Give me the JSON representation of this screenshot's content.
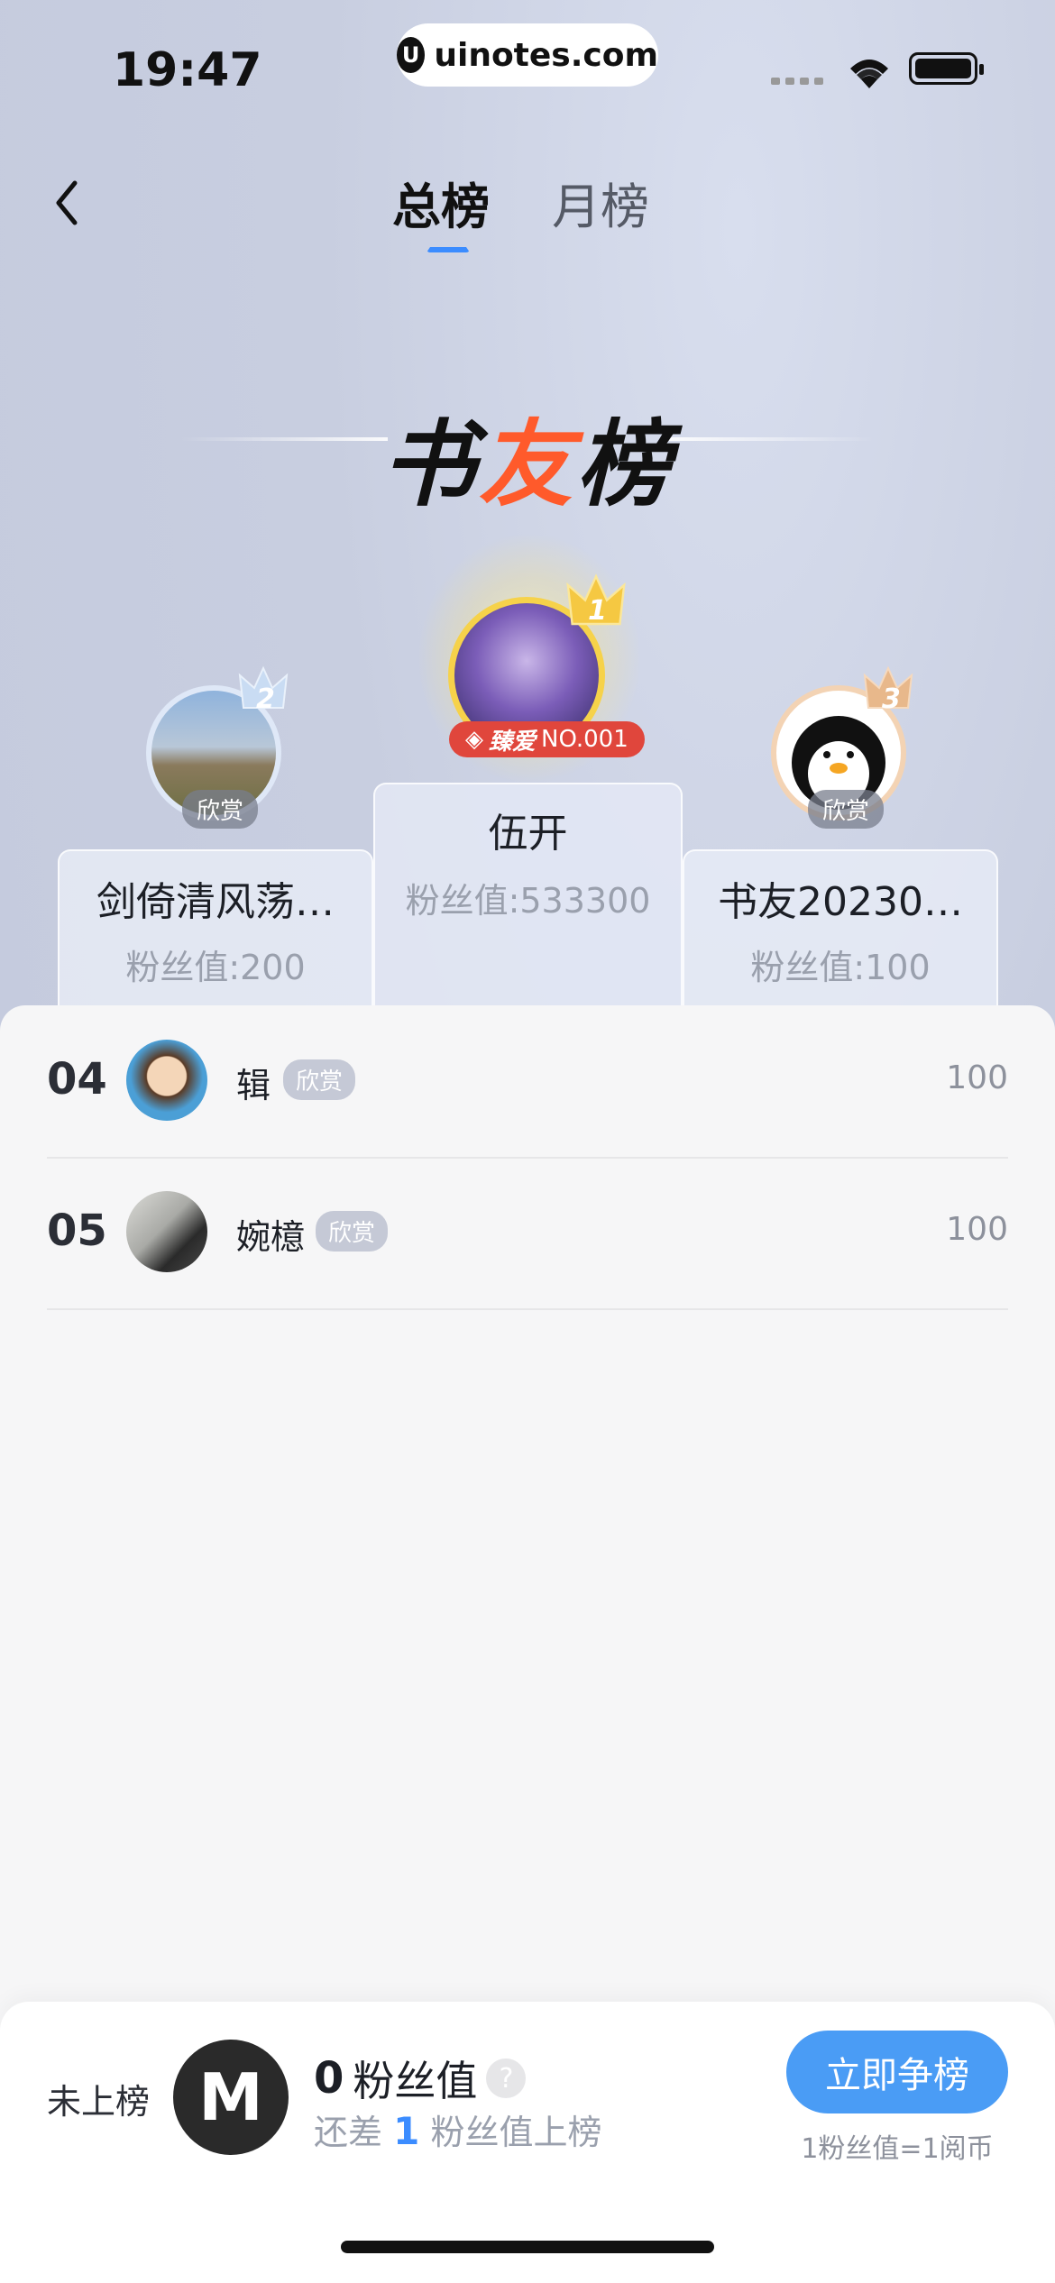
{
  "status_bar": {
    "time": "19:47",
    "url": "uinotes.com"
  },
  "nav": {
    "tabs": [
      {
        "label": "总榜",
        "active": true
      },
      {
        "label": "月榜",
        "active": false
      }
    ]
  },
  "title": {
    "part1": "书",
    "accent": "友",
    "part2": "榜"
  },
  "podium": [
    {
      "rank": "1",
      "name": "伍开",
      "fans": "粉丝值:533300",
      "badge": "NO.001",
      "badge_prefix": "臻爱"
    },
    {
      "rank": "2",
      "name": "剑倚清风荡…",
      "fans": "粉丝值:200",
      "tag": "欣赏"
    },
    {
      "rank": "3",
      "name": "书友20230…",
      "fans": "粉丝值:100",
      "tag": "欣赏"
    }
  ],
  "list": [
    {
      "rank": "04",
      "name": "辑",
      "tag": "欣赏",
      "value": "100"
    },
    {
      "rank": "05",
      "name": "婉檍",
      "tag": "欣赏",
      "value": "100"
    }
  ],
  "bottom": {
    "status": "未上榜",
    "avatar_letter": "M",
    "score_num": "0",
    "score_label": "粉丝值",
    "help": "?",
    "gap_prefix": "还差",
    "gap_num": "1",
    "gap_suffix": "粉丝值上榜",
    "cta": "立即争榜",
    "rate": "1粉丝值=1阅币"
  },
  "colors": {
    "accent": "#3b8cff",
    "cta": "#4a9cf5",
    "title_accent": "#ff5a2b",
    "badge": "#e0463c"
  }
}
